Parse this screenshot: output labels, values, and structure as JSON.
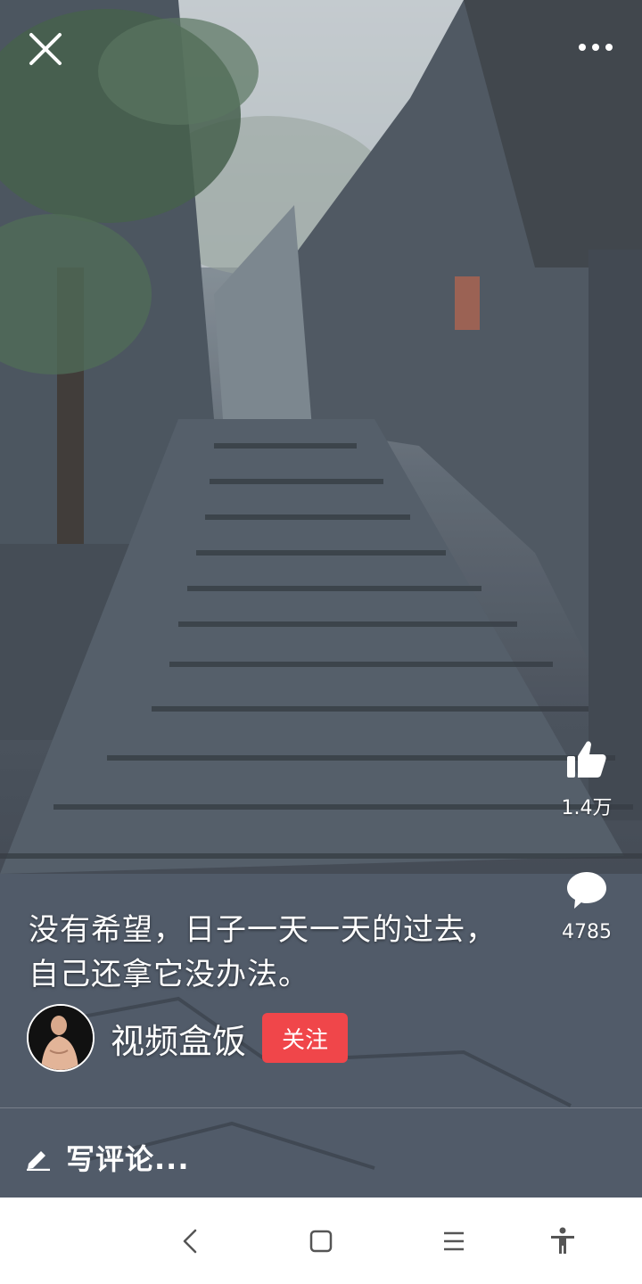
{
  "video": {
    "caption_lines": [
      "没有希望，日子一天一天的过去，",
      "自己还拿它没办法。"
    ]
  },
  "actions": {
    "like_count": "1.4万",
    "comment_count": "4785"
  },
  "author": {
    "name": "视频盒饭",
    "follow_label": "关注"
  },
  "comment_input": {
    "placeholder": "写评论..."
  },
  "icons": {
    "close": "close-icon",
    "more": "more-icon",
    "like": "thumbs-up-icon",
    "comment": "comment-bubble-icon",
    "edit": "pencil-icon",
    "nav_back": "back-icon",
    "nav_home": "home-icon",
    "nav_menu": "menu-icon",
    "nav_accessibility": "accessibility-icon"
  },
  "colors": {
    "follow_button": "#f0464a",
    "nav_background": "#ffffff",
    "nav_icon": "#555555"
  }
}
